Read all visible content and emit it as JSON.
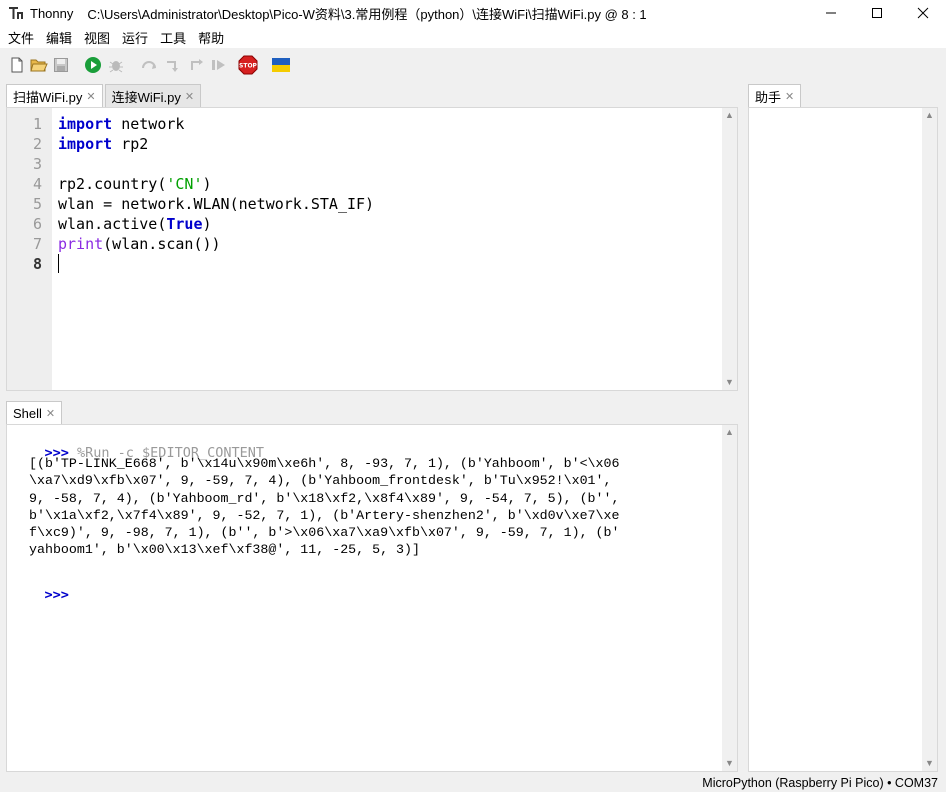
{
  "window": {
    "app_name": "Thonny",
    "path_title": "C:\\Users\\Administrator\\Desktop\\Pico-W资料\\3.常用例程（python）\\连接WiFi\\扫描WiFi.py  @  8 : 1"
  },
  "menu": [
    "文件",
    "编辑",
    "视图",
    "运行",
    "工具",
    "帮助"
  ],
  "toolbar": {
    "icons": [
      "new-file-icon",
      "open-file-icon",
      "save-icon",
      "run-icon",
      "debug-icon",
      "step-over-icon",
      "step-into-icon",
      "step-out-icon",
      "resume-icon",
      "stop-icon",
      "ukraine-flag-icon"
    ],
    "stop_label": "STOP"
  },
  "editor": {
    "tabs": [
      {
        "label": "扫描WiFi.py",
        "active": true
      },
      {
        "label": "连接WiFi.py",
        "active": false
      }
    ],
    "line_numbers": [
      "1",
      "2",
      "3",
      "4",
      "5",
      "6",
      "7",
      "8"
    ],
    "lines": [
      [
        {
          "t": "import",
          "c": "kw"
        },
        {
          "t": " network",
          "c": ""
        }
      ],
      [
        {
          "t": "import",
          "c": "kw"
        },
        {
          "t": " rp2",
          "c": ""
        }
      ],
      [],
      [
        {
          "t": "rp2.country(",
          "c": ""
        },
        {
          "t": "'CN'",
          "c": "str"
        },
        {
          "t": ")",
          "c": ""
        }
      ],
      [
        {
          "t": "wlan = network.WLAN(network.STA_IF)",
          "c": ""
        }
      ],
      [
        {
          "t": "wlan.active(",
          "c": ""
        },
        {
          "t": "True",
          "c": "kw"
        },
        {
          "t": ")",
          "c": ""
        }
      ],
      [
        {
          "t": "print",
          "c": "bi"
        },
        {
          "t": "(wlan.scan())",
          "c": ""
        }
      ],
      []
    ],
    "current_line": 8
  },
  "shell": {
    "tab_label": "Shell",
    "prompt": ">>>",
    "command": " %Run -c $EDITOR_CONTENT",
    "output": "[(b'TP-LINK_E668', b'\\x14u\\x90m\\xe6h', 8, -93, 7, 1), (b'Yahboom', b'<\\x06\n\\xa7\\xd9\\xfb\\x07', 9, -59, 7, 4), (b'Yahboom_frontdesk', b'Tu\\x952!\\x01',\n9, -58, 7, 4), (b'Yahboom_rd', b'\\x18\\xf2,\\x8f4\\x89', 9, -54, 7, 5), (b'',\nb'\\x1a\\xf2,\\x7f4\\x89', 9, -52, 7, 1), (b'Artery-shenzhen2', b'\\xd0v\\xe7\\xe\nf\\xc9)', 9, -98, 7, 1), (b'', b'>\\x06\\xa7\\xa9\\xfb\\x07', 9, -59, 7, 1), (b'\nyahboom1', b'\\x00\\x13\\xef\\xf38@', 11, -25, 5, 3)]",
    "final_prompt": ">>>"
  },
  "assistant": {
    "tab_label": "助手"
  },
  "status_bar": {
    "interpreter": "MicroPython (Raspberry Pi Pico)  •  COM37"
  },
  "colors": {
    "keyword": "#0000cc",
    "string": "#00a000",
    "builtin": "#8a2be2"
  }
}
